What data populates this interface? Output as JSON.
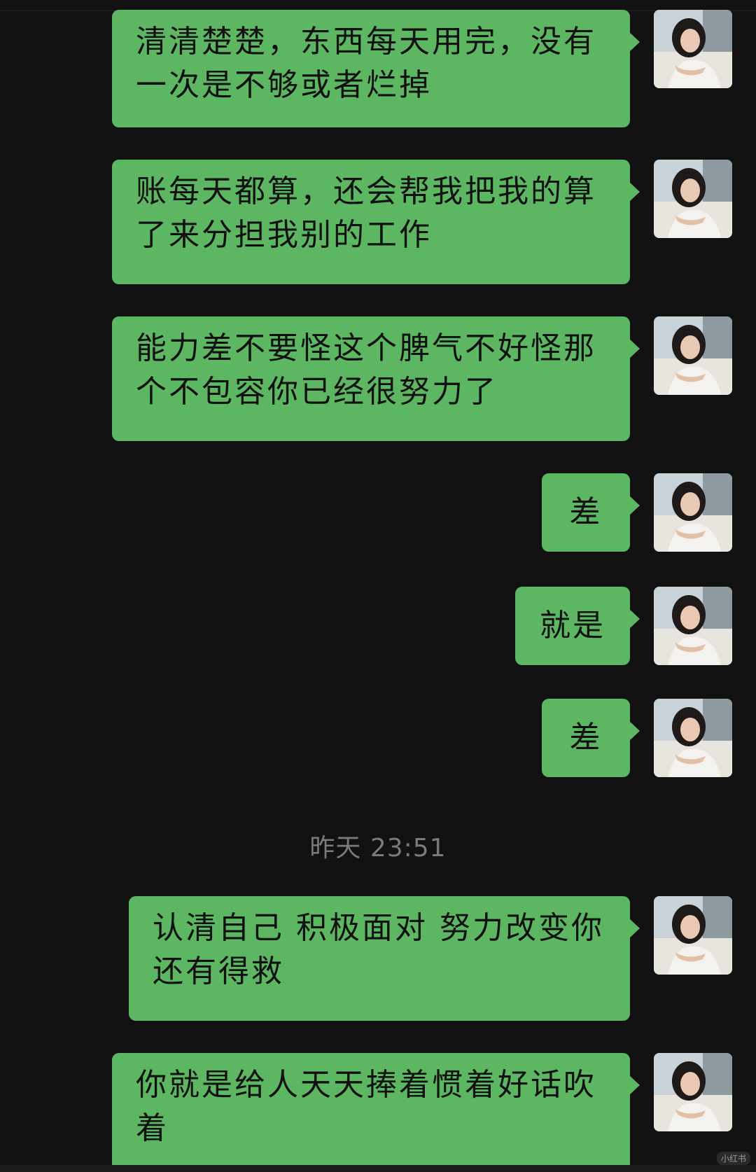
{
  "messages": [
    {
      "text": "清清楚楚，东西每天用完，没有一次是不够或者烂掉",
      "sender": "self"
    },
    {
      "text": "账每天都算，还会帮我把我的算了来分担我别的工作",
      "sender": "self"
    },
    {
      "text": "能力差不要怪这个脾气不好怪那个不包容你已经很努力了",
      "sender": "self"
    },
    {
      "text": "差",
      "sender": "self"
    },
    {
      "text": "就是",
      "sender": "self"
    },
    {
      "text": "差",
      "sender": "self"
    },
    {
      "text": "认清自己 积极面对 努力改变你还有得救",
      "sender": "self"
    },
    {
      "text": "你就是给人天天捧着惯着好话吹着",
      "sender": "self"
    }
  ],
  "timestamp": "昨天 23:51",
  "watermark": "小红书",
  "colors": {
    "background": "#111111",
    "bubble": "#5cb662",
    "timestamp": "#7a7a7a"
  }
}
